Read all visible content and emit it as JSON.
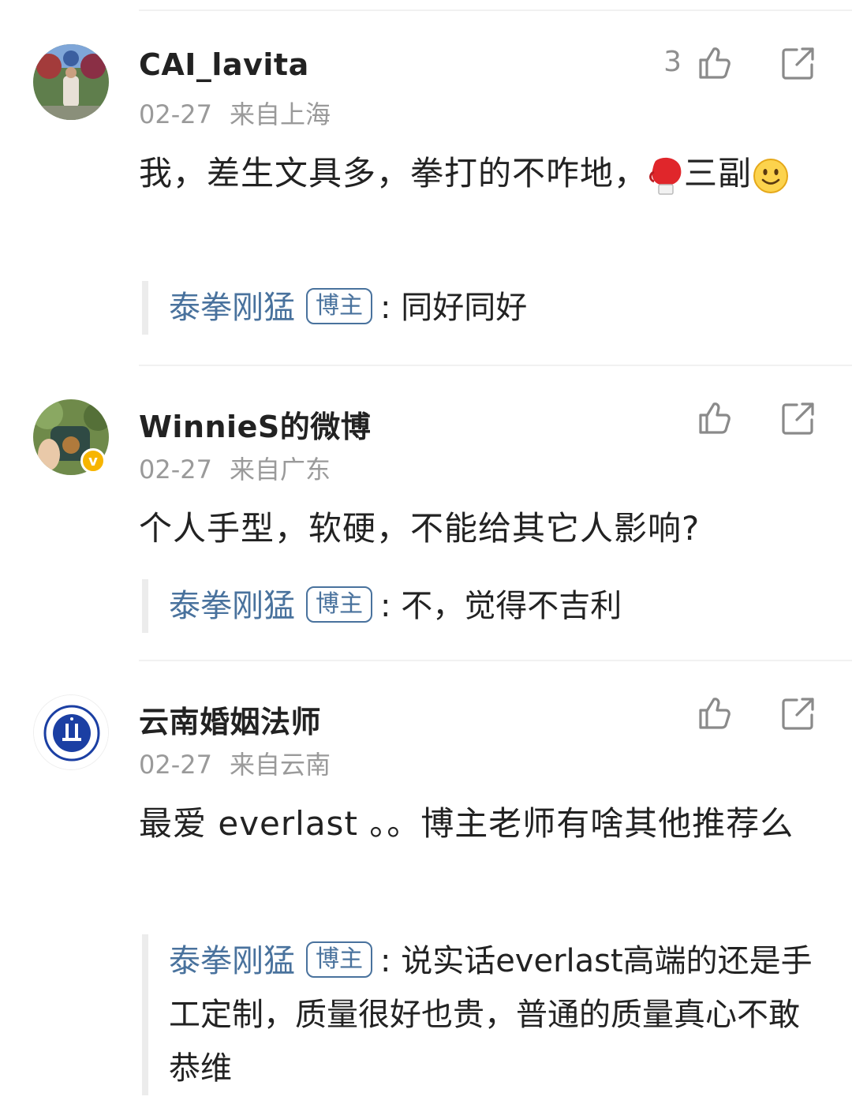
{
  "comments": [
    {
      "username": "CAI_lavita",
      "date": "02-27",
      "location": "来自上海",
      "like_count": "3",
      "text_a": "我，差生文具多，拳打的不咋地，",
      "text_b": "三副",
      "emoji_1": "boxing-glove",
      "emoji_2": "smiley",
      "reply": {
        "name": "泰拳刚猛",
        "tag": "博主",
        "sep": ":",
        "text": "同好同好"
      }
    },
    {
      "username": "WinnieS的微博",
      "date": "02-27",
      "location": "来自广东",
      "verified_badge": "v",
      "text": "个人手型，软硬，不能给其它人影响?",
      "reply": {
        "name": "泰拳刚猛",
        "tag": "博主",
        "sep": ":",
        "text": "不，觉得不吉利"
      }
    },
    {
      "username": "云南婚姻法师",
      "date": "02-27",
      "location": "来自云南",
      "text": "最爱 everlast 。。博主老师有啥其他推荐么",
      "reply": {
        "name": "泰拳刚猛",
        "tag": "博主",
        "sep": ":",
        "text": "说实话everlast高端的还是手工定制，质量很好也贵，普通的质量真心不敢恭维"
      }
    }
  ],
  "icons": {
    "like": "thumbs-up-icon",
    "share": "share-icon"
  },
  "colors": {
    "reply_name": "#49729d",
    "meta": "#9a9a9a",
    "badge": "#f7b500"
  }
}
